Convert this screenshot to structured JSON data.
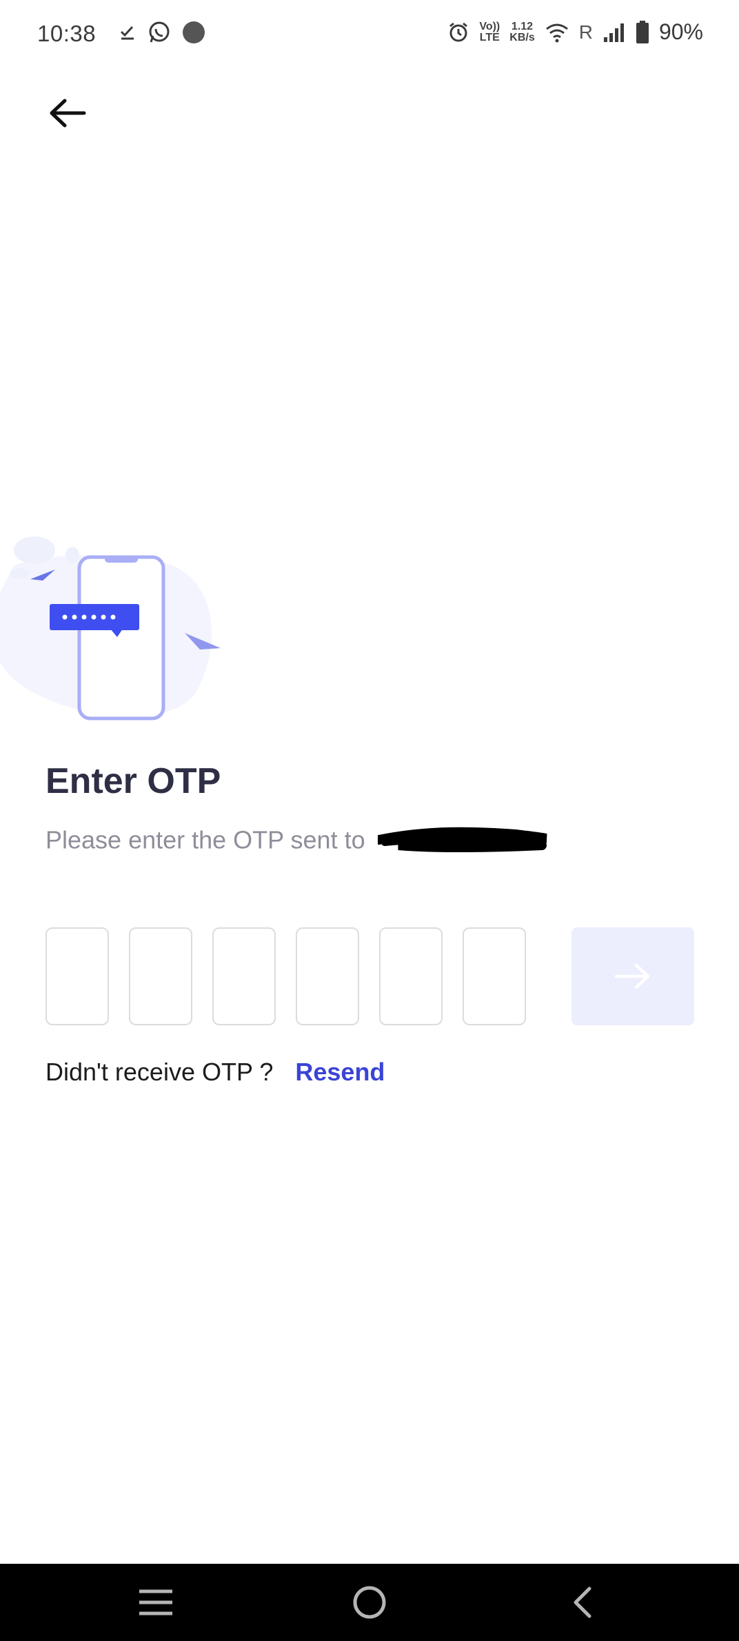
{
  "status_bar": {
    "time": "10:38",
    "data_speed_value": "1.12",
    "data_speed_unit": "KB/s",
    "volte_top": "Vo))",
    "volte_bottom": "LTE",
    "roaming": "R",
    "battery": "90%"
  },
  "page": {
    "title": "Enter OTP",
    "subtitle": "Please enter the OTP sent to",
    "otp_boxes": [
      "",
      "",
      "",
      "",
      "",
      ""
    ],
    "resend_prompt": "Didn't receive OTP ?",
    "resend_label": "Resend"
  },
  "colors": {
    "accent": "#3a44d6",
    "illustration_primary": "#3f4ef0",
    "illustration_light": "#9ea6f8",
    "submit_bg": "#eceefd",
    "title": "#2e2f45",
    "subtitle": "#8e8e9a"
  },
  "icons": {
    "back": "arrow-left-icon",
    "submit": "arrow-right-icon",
    "nav_recents": "menu-icon",
    "nav_home": "circle-icon",
    "nav_back": "chevron-left-icon"
  }
}
